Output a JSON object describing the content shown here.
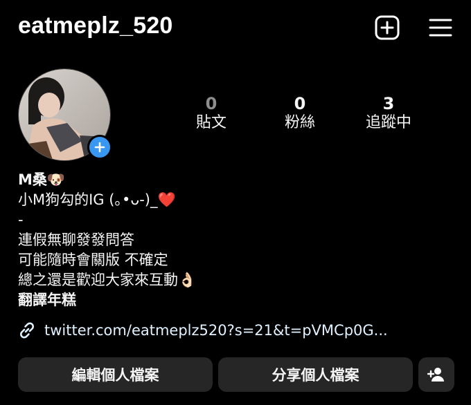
{
  "header": {
    "username": "eatmeplz_520",
    "create_icon": "plus-square-icon",
    "menu_icon": "hamburger-menu-icon"
  },
  "profile": {
    "avatar_add_icon": "plus-icon",
    "stats": [
      {
        "count": "0",
        "label": "貼文"
      },
      {
        "count": "0",
        "label": "粉絲"
      },
      {
        "count": "3",
        "label": "追蹤中"
      }
    ]
  },
  "bio": {
    "name": "M桑🐶",
    "lines": [
      "小M狗勾的IG (｡•ᴗ-)_❤️",
      "-",
      "連假無聊發發問答",
      "可能隨時會關版 不確定",
      "總之還是歡迎大家來互動👌🏻",
      "翻譯年糕"
    ]
  },
  "link": {
    "icon": "link-icon",
    "text": "twitter.com/eatmeplz520?s=21&t=pVMCp0G..."
  },
  "actions": {
    "edit_label": "編輯個人檔案",
    "share_label": "分享個人檔案",
    "add_user_icon": "add-person-icon"
  },
  "colors": {
    "background": "#000000",
    "button_bg": "#262626",
    "badge_blue": "#3897f0",
    "link_text": "#e0f1ff"
  }
}
